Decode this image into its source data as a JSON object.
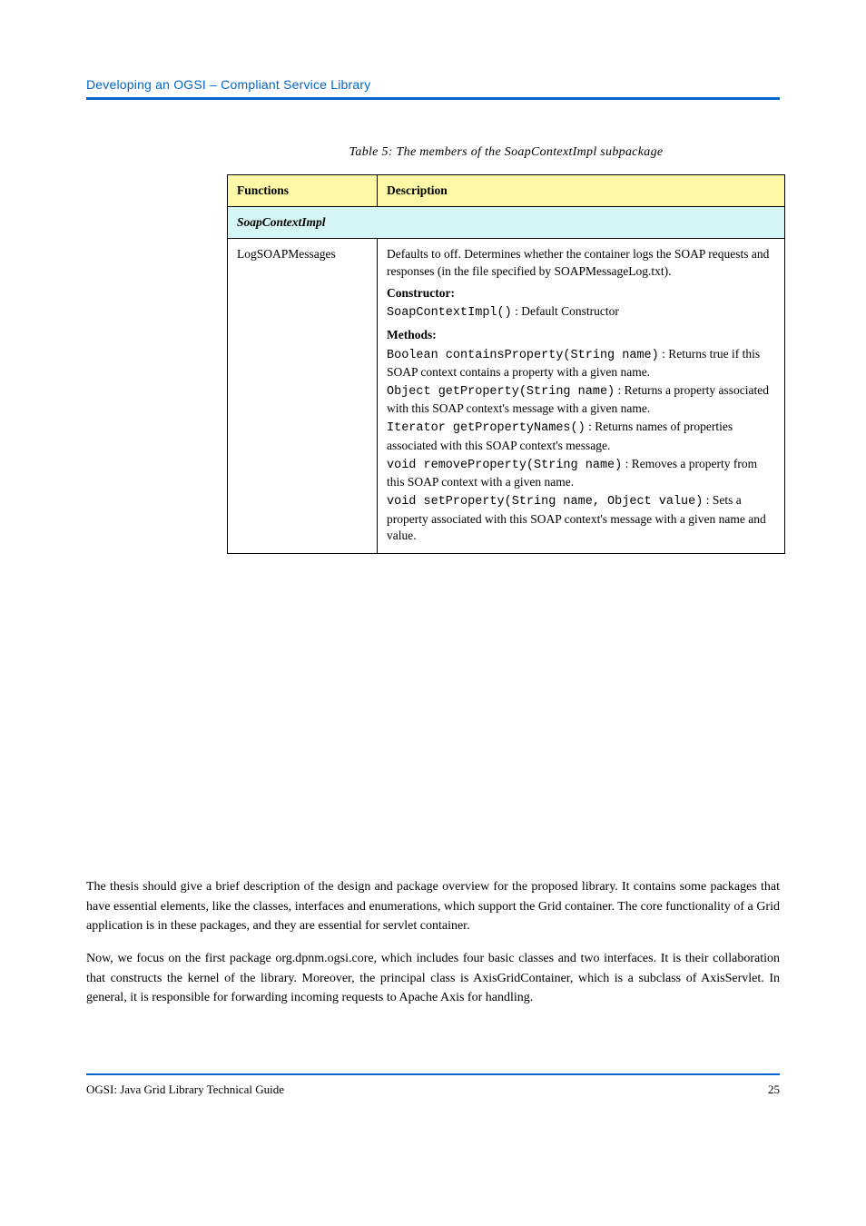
{
  "header": {
    "title": "Developing an OGSI – Compliant Service Library"
  },
  "table": {
    "caption": "Table 5: The members of the SoapContextImpl subpackage",
    "columns": {
      "functions": "Functions",
      "description": "Description"
    },
    "section_label": "SoapContextImpl",
    "row": {
      "functions": "LogSOAPMessages",
      "description": {
        "intro_prefix": "Defaults to off. Determines whether the container logs the SOAP requests and responses (in the file specified by ",
        "intro_file": "SOAPMessageLog.txt",
        "intro_suffix": ").",
        "constructor_label": "Constructor:",
        "constructor_fn": "SoapContextImpl()",
        "constructor_desc": " : Default Constructor",
        "methods_label": "Methods:",
        "methods": [
          {
            "sig": "Boolean containsProperty(String name)",
            "desc": " : Returns true if this SOAP context contains a property with a given name."
          },
          {
            "sig": "Object getProperty(String name)",
            "desc": " : Returns a property associated with this SOAP context's message with a given name."
          },
          {
            "sig": "Iterator getPropertyNames()",
            "desc": " : Returns names of properties associated with this SOAP context's message."
          },
          {
            "sig": "void removeProperty(String name)",
            "desc": " : Removes a property from this SOAP context with a given name."
          },
          {
            "sig": "void setProperty(String name, Object value)",
            "desc": " : Sets a property associated with this SOAP context's message with a given name and value."
          }
        ]
      }
    }
  },
  "body": {
    "p1": "The thesis should give a brief description of the design and package overview for the proposed library. It contains some packages that have essential elements, like the classes, interfaces and enumerations, which support the Grid container. The core functionality of a Grid application is in these packages, and they are essential for servlet container.",
    "p2": "Now, we focus on the first package org.dpnm.ogsi.core, which includes four basic classes and two interfaces. It is their collaboration that constructs the kernel of the library. Moreover, the principal class is AxisGridContainer, which is a subclass of AxisServlet. In general, it is responsible for forwarding incoming requests to Apache Axis for handling."
  },
  "footer": {
    "left": "OGSI: Java Grid Library Technical Guide",
    "right": "25"
  }
}
